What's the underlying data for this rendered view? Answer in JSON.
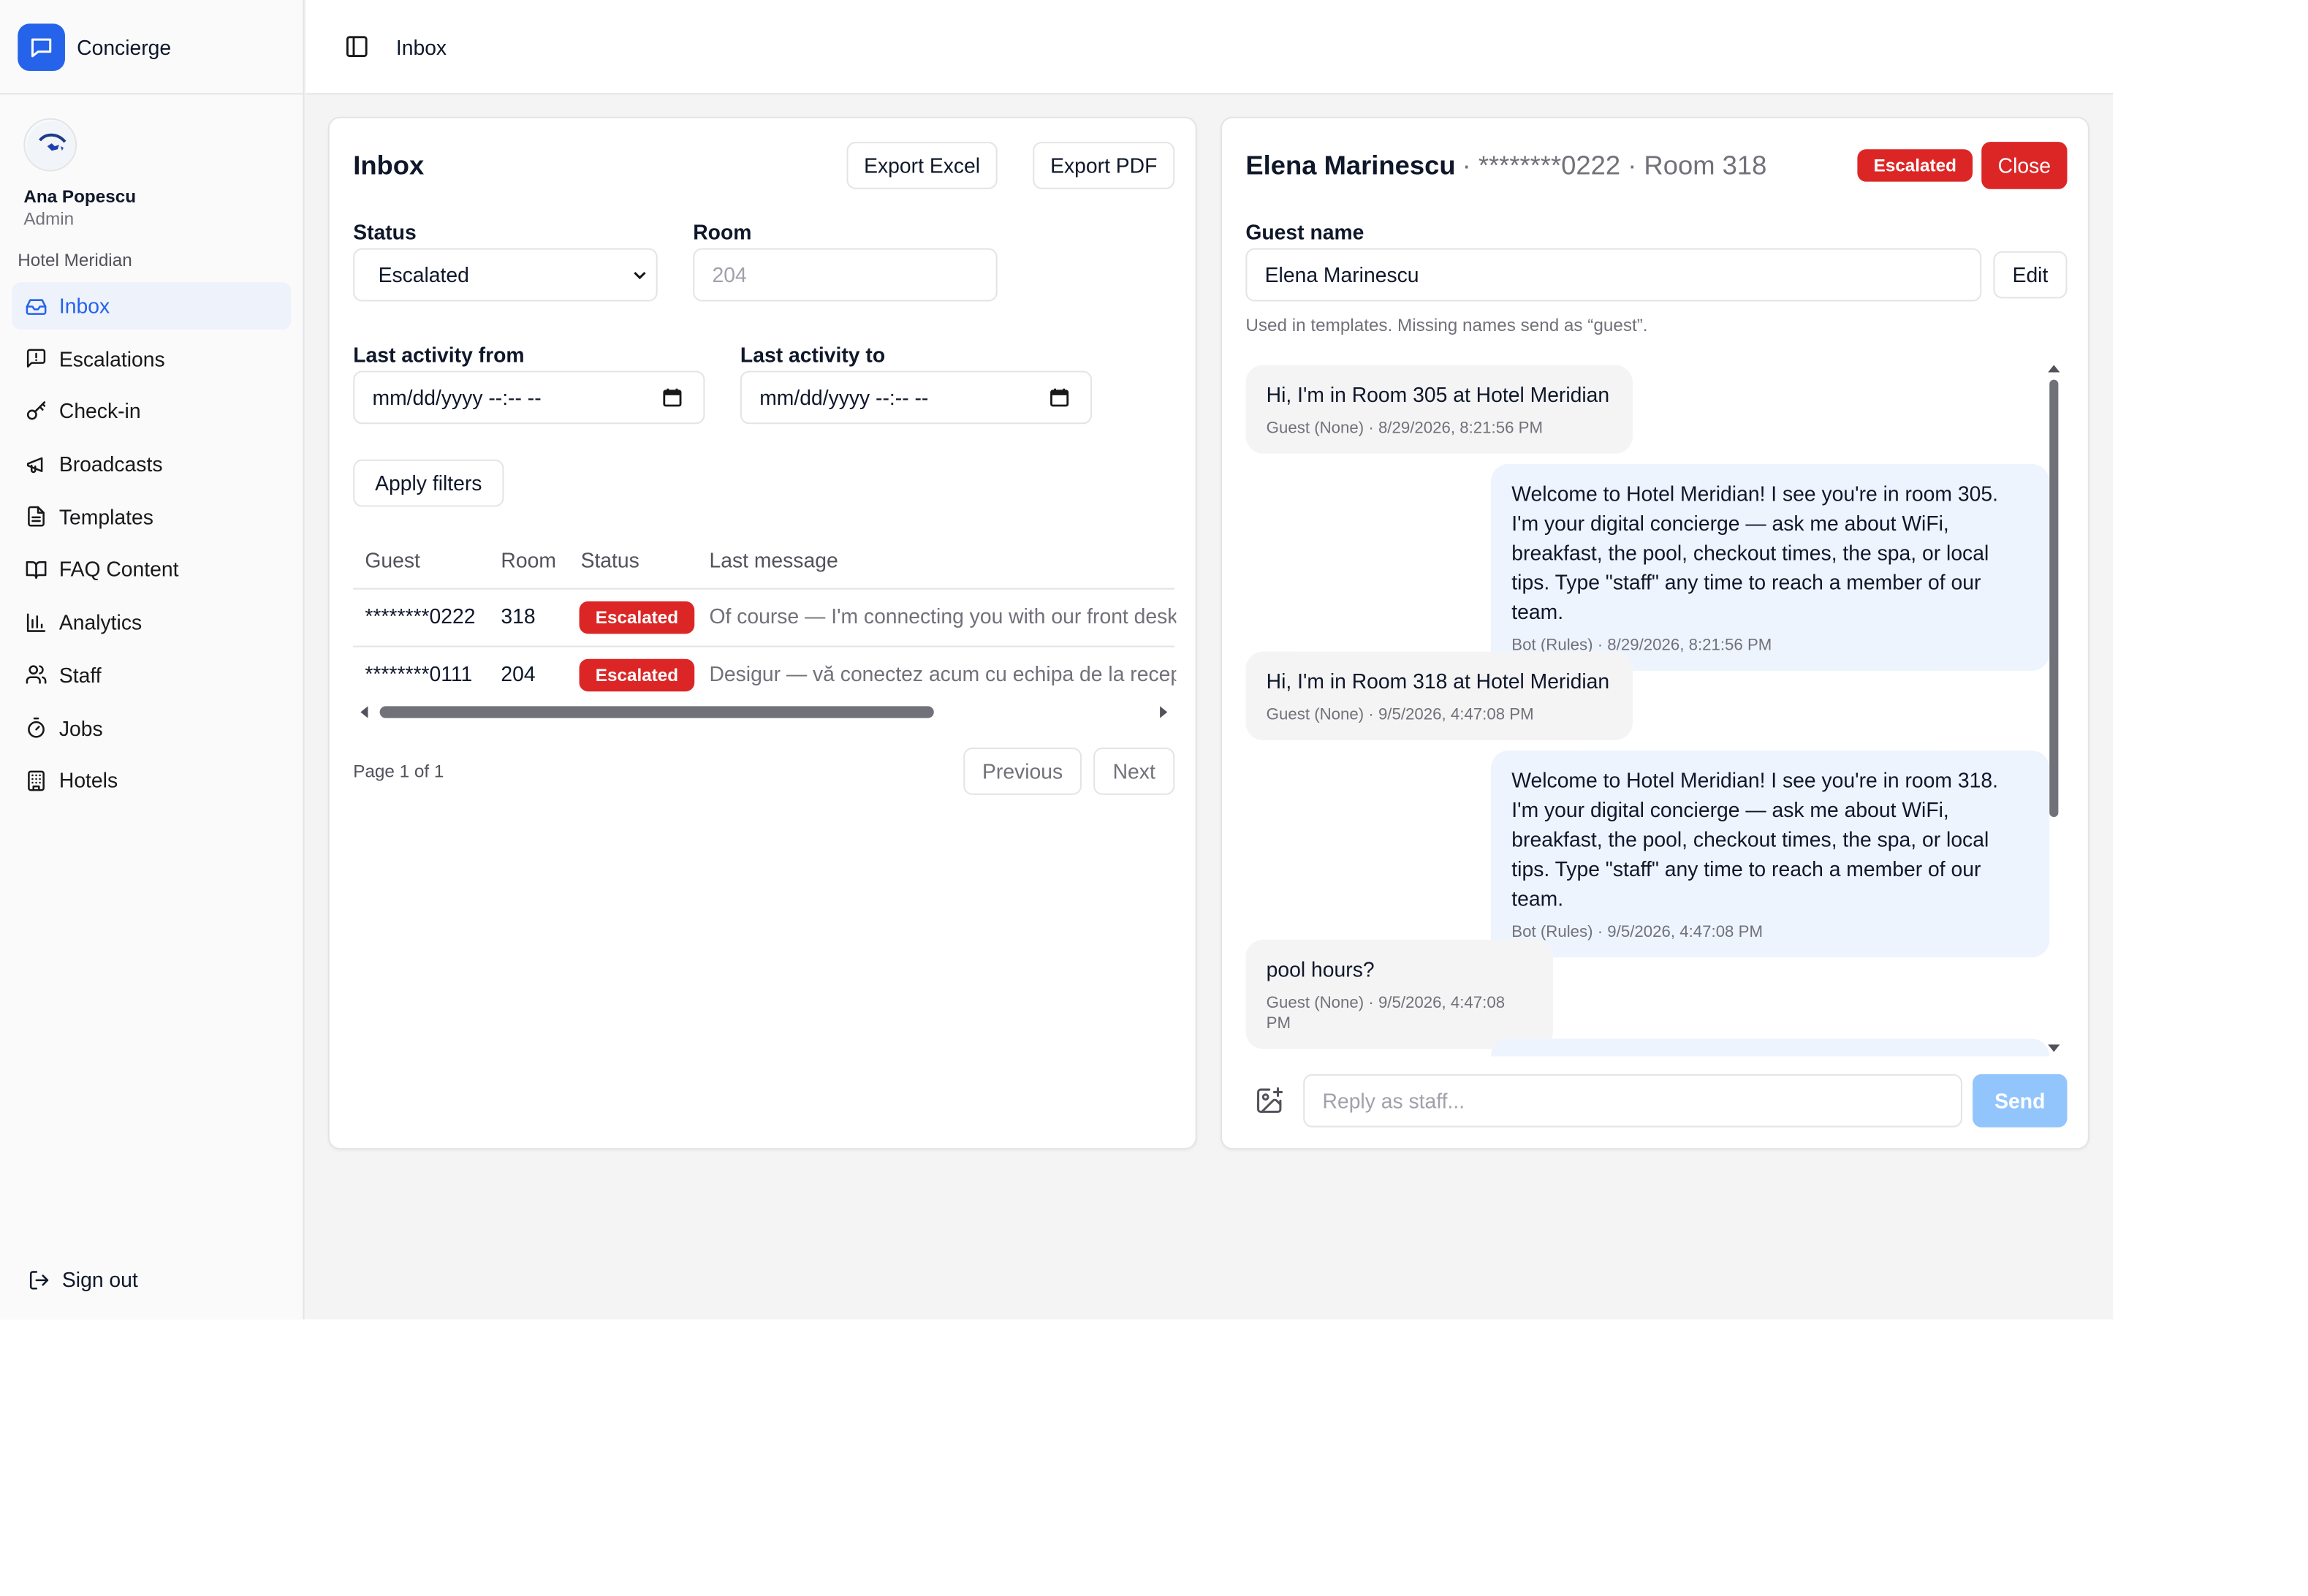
{
  "app": {
    "name": "Concierge",
    "accent": "#2563eb",
    "danger": "#dc2626"
  },
  "user": {
    "name": "Ana Popescu",
    "role": "Admin",
    "hotel": "Hotel Meridian"
  },
  "nav": {
    "items": [
      {
        "label": "Inbox",
        "icon": "inbox-icon",
        "active": true
      },
      {
        "label": "Escalations",
        "icon": "message-alert-icon"
      },
      {
        "label": "Check-in",
        "icon": "key-icon"
      },
      {
        "label": "Broadcasts",
        "icon": "megaphone-icon"
      },
      {
        "label": "Templates",
        "icon": "file-text-icon"
      },
      {
        "label": "FAQ Content",
        "icon": "book-open-icon"
      },
      {
        "label": "Analytics",
        "icon": "bar-chart-icon"
      },
      {
        "label": "Staff",
        "icon": "users-icon"
      },
      {
        "label": "Jobs",
        "icon": "timer-icon"
      },
      {
        "label": "Hotels",
        "icon": "building-icon"
      }
    ],
    "signout": "Sign out"
  },
  "topbar": {
    "breadcrumb": "Inbox"
  },
  "inbox": {
    "title": "Inbox",
    "export_excel": "Export Excel",
    "export_pdf": "Export PDF",
    "filters": {
      "status_label": "Status",
      "status_value": "Escalated",
      "room_label": "Room",
      "room_placeholder": "204",
      "from_label": "Last activity from",
      "from_value": "mm/dd/yyyy --:-- --",
      "to_label": "Last activity to",
      "to_value": "mm/dd/yyyy --:-- --",
      "apply": "Apply filters"
    },
    "table": {
      "columns": [
        "Guest",
        "Room",
        "Status",
        "Last message"
      ],
      "rows": [
        {
          "guest": "********0222",
          "room": "318",
          "status": "Escalated",
          "last_message": "Of course — I'm connecting you with our front desk"
        },
        {
          "guest": "********0111",
          "room": "204",
          "status": "Escalated",
          "last_message": "Desigur — vă conectez acum cu echipa de la recepție"
        }
      ]
    },
    "pagination": {
      "info": "Page 1 of 1",
      "previous": "Previous",
      "next": "Next"
    }
  },
  "conversation": {
    "guest_name": "Elena Marinescu",
    "sub": "· ********0222 · Room 318",
    "status": "Escalated",
    "close": "Close",
    "guest_name_label": "Guest name",
    "guest_name_value": "Elena Marinescu",
    "edit": "Edit",
    "help": "Used in templates. Missing names send as “guest”.",
    "messages": [
      {
        "from": "guest",
        "text": "Hi, I'm in Room 305 at Hotel Meridian",
        "meta": "Guest (None) · 8/29/2026, 8:21:56 PM"
      },
      {
        "from": "bot",
        "text": "Welcome to Hotel Meridian! I see you're in room 305. I'm your digital concierge — ask me about WiFi, breakfast, the pool, checkout times, the spa, or local tips. Type \"staff\" any time to reach a member of our team.",
        "meta": "Bot (Rules) · 8/29/2026, 8:21:56 PM"
      },
      {
        "from": "guest",
        "text": "Hi, I'm in Room 318 at Hotel Meridian",
        "meta": "Guest (None) · 9/5/2026, 4:47:08 PM"
      },
      {
        "from": "bot",
        "text": "Welcome to Hotel Meridian! I see you're in room 318. I'm your digital concierge — ask me about WiFi, breakfast, the pool, checkout times, the spa, or local tips. Type \"staff\" any time to reach a member of our team.",
        "meta": "Bot (Rules) · 9/5/2026, 4:47:08 PM"
      },
      {
        "from": "guest",
        "text": "pool hours?",
        "meta": "Guest (None) · 9/5/2026, 4:47:08 PM"
      }
    ],
    "reply_placeholder": "Reply as staff...",
    "send": "Send"
  }
}
